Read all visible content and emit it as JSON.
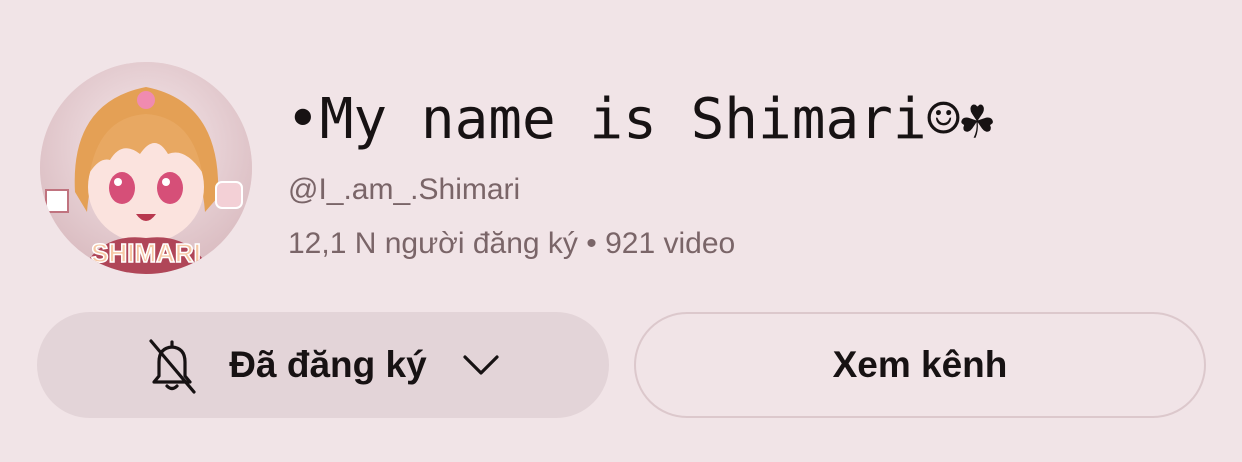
{
  "channel": {
    "name": "•My name is Shimari☺☘",
    "handle": "@I_.am_.Shimari",
    "stats": "12,1 N người đăng ký • 921 video",
    "avatar_text": "SHIMARI"
  },
  "actions": {
    "subscribed_label": "Đã đăng ký",
    "view_channel_label": "Xem kênh"
  },
  "icons": {
    "bell": "bell-off-icon",
    "chevron": "chevron-down-icon"
  },
  "colors": {
    "background": "#f1e4e7",
    "button_fill": "#e3d4d8",
    "text_primary": "#171213",
    "text_secondary": "#7a6568"
  }
}
